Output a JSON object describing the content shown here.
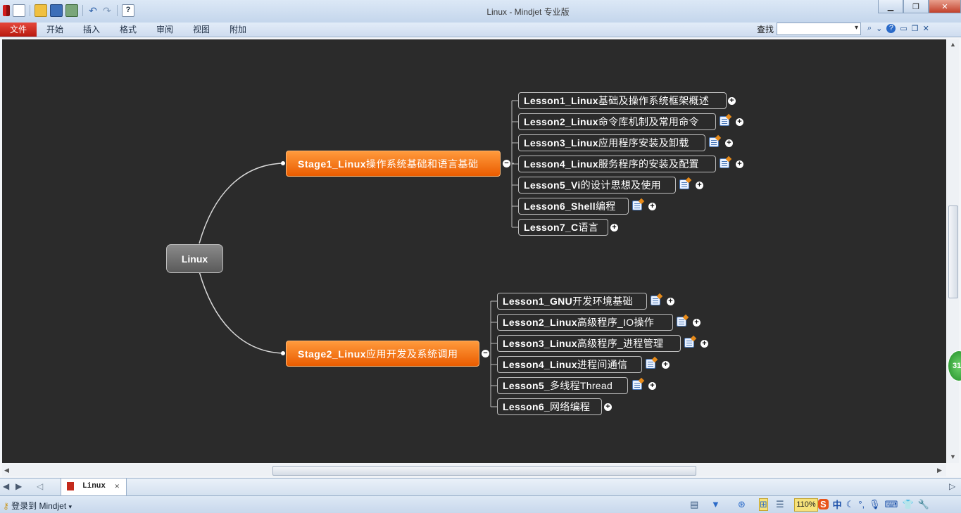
{
  "window": {
    "title": "Linux - Mindjet 专业版"
  },
  "ribbon": {
    "file": "文件",
    "tabs": [
      "开始",
      "插入",
      "格式",
      "审阅",
      "视图",
      "附加"
    ],
    "find_label": "查找"
  },
  "map": {
    "central": "Linux",
    "stages": [
      {
        "prefix": "Stage1_Linux",
        "suffix": "操作系统基础和语言基础",
        "collapse": "−",
        "lessons": [
          {
            "prefix": "Lesson1_Linux",
            "suffix": "基础及操作系统框架概述",
            "has_note": false,
            "expand": "+"
          },
          {
            "prefix": "Lesson2_Linux",
            "suffix": "命令库机制及常用命令",
            "has_note": true,
            "expand": "+"
          },
          {
            "prefix": "Lesson3_Linux",
            "suffix": "应用程序安装及卸载",
            "has_note": true,
            "expand": "+"
          },
          {
            "prefix": "Lesson4_Linux",
            "suffix": "服务程序的安装及配置",
            "has_note": true,
            "expand": "+"
          },
          {
            "prefix": "Lesson5_Vi",
            "suffix": "的设计思想及使用",
            "has_note": true,
            "expand": "+"
          },
          {
            "prefix": "Lesson6_Shell",
            "suffix": "编程",
            "has_note": true,
            "expand": "+"
          },
          {
            "prefix": "Lesson7_C",
            "suffix": "语言",
            "has_note": false,
            "expand": "+"
          }
        ]
      },
      {
        "prefix": "Stage2_Linux",
        "suffix": "应用开发及系统调用",
        "collapse": "−",
        "lessons": [
          {
            "prefix": "Lesson1_GNU",
            "suffix": "开发环境基础",
            "has_note": true,
            "expand": "+"
          },
          {
            "prefix": "Lesson2_Linux",
            "suffix": "高级程序_IO操作",
            "has_note": true,
            "expand": "+"
          },
          {
            "prefix": "Lesson3_Linux",
            "suffix": "高级程序_进程管理",
            "has_note": true,
            "expand": "+"
          },
          {
            "prefix": "Lesson4_Linux",
            "suffix": "进程间通信",
            "has_note": true,
            "expand": "+"
          },
          {
            "prefix": "Lesson5_",
            "suffix": "多线程Thread",
            "has_note": true,
            "expand": "+"
          },
          {
            "prefix": "Lesson6_",
            "suffix": "网络编程",
            "has_note": false,
            "expand": "+"
          }
        ]
      }
    ]
  },
  "side_badge": "31",
  "tabs_bar": {
    "doc_tab": "Linux"
  },
  "status": {
    "login": "登录到 Mindjet",
    "zoom": "110%",
    "ime": "中"
  },
  "colors": {
    "canvas": "#2b2b2b",
    "stage": "#ea5c00",
    "central": "#6e6e6e",
    "file_tab": "#c42a1c"
  },
  "icons": [
    "new-icon",
    "open-icon",
    "save-icon",
    "print-icon",
    "undo-icon",
    "redo-icon",
    "help-icon",
    "minimize-icon",
    "restore-icon",
    "close-icon",
    "note-icon",
    "expand-icon",
    "collapse-icon",
    "filter-icon",
    "sogou-icon"
  ]
}
